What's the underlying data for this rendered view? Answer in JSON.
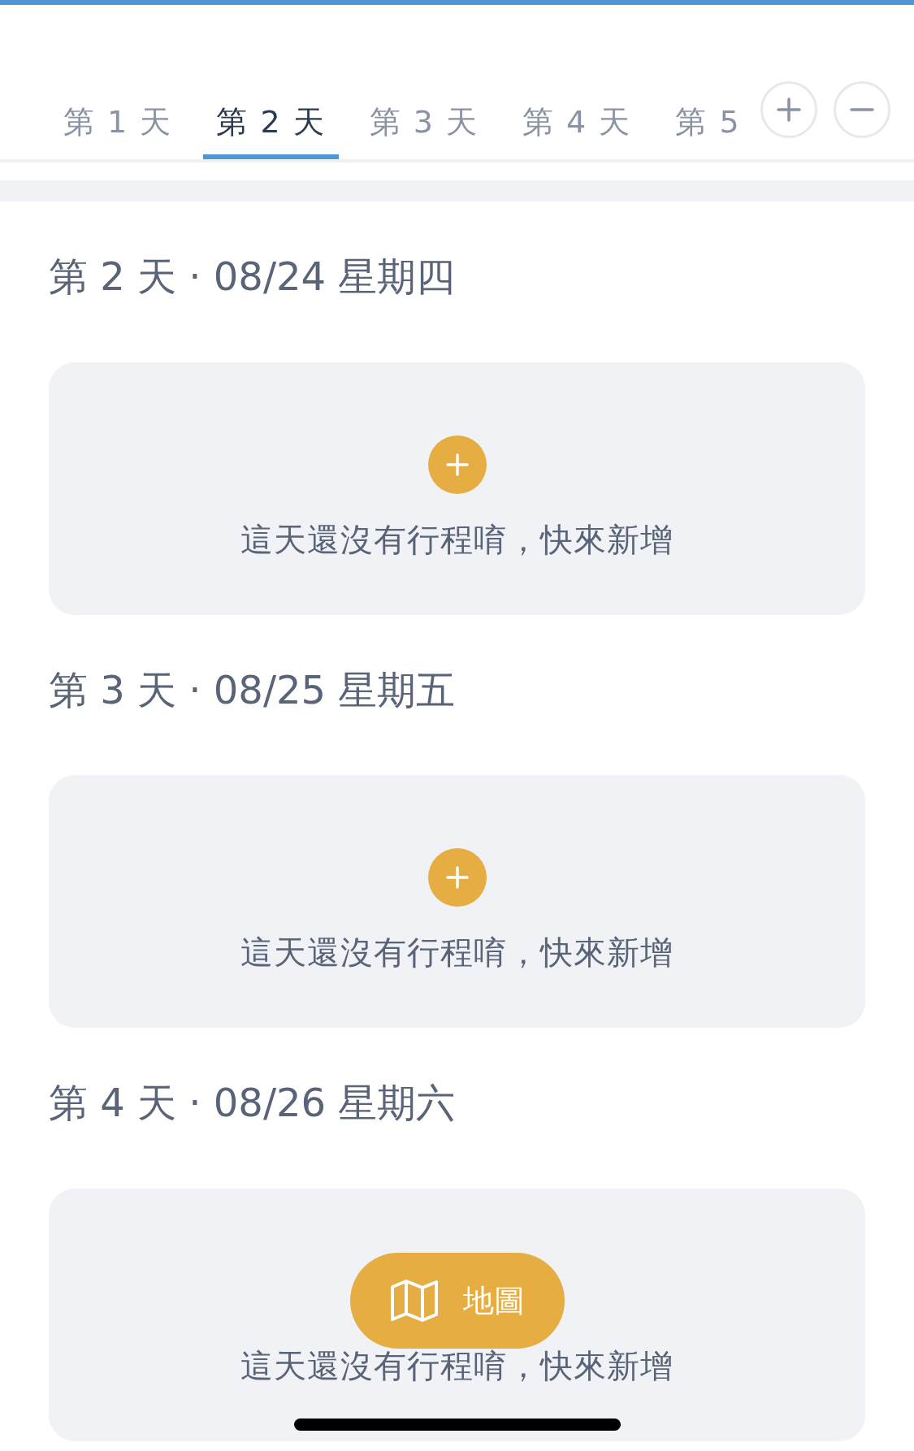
{
  "tabs": [
    {
      "label": "第 1 天",
      "selected": false
    },
    {
      "label": "第 2 天",
      "selected": true
    },
    {
      "label": "第 3 天",
      "selected": false
    },
    {
      "label": "第 4 天",
      "selected": false
    },
    {
      "label": "第 5",
      "selected": false
    }
  ],
  "days": [
    {
      "heading": "第 2 天 · 08/24 星期四",
      "empty_message": "這天還沒有行程唷，快來新增"
    },
    {
      "heading": "第 3 天 · 08/25 星期五",
      "empty_message": "這天還沒有行程唷，快來新增"
    },
    {
      "heading": "第 4 天 · 08/26 星期六",
      "empty_message": "這天還沒有行程唷，快來新增"
    }
  ],
  "map_button": {
    "label": "地圖"
  }
}
